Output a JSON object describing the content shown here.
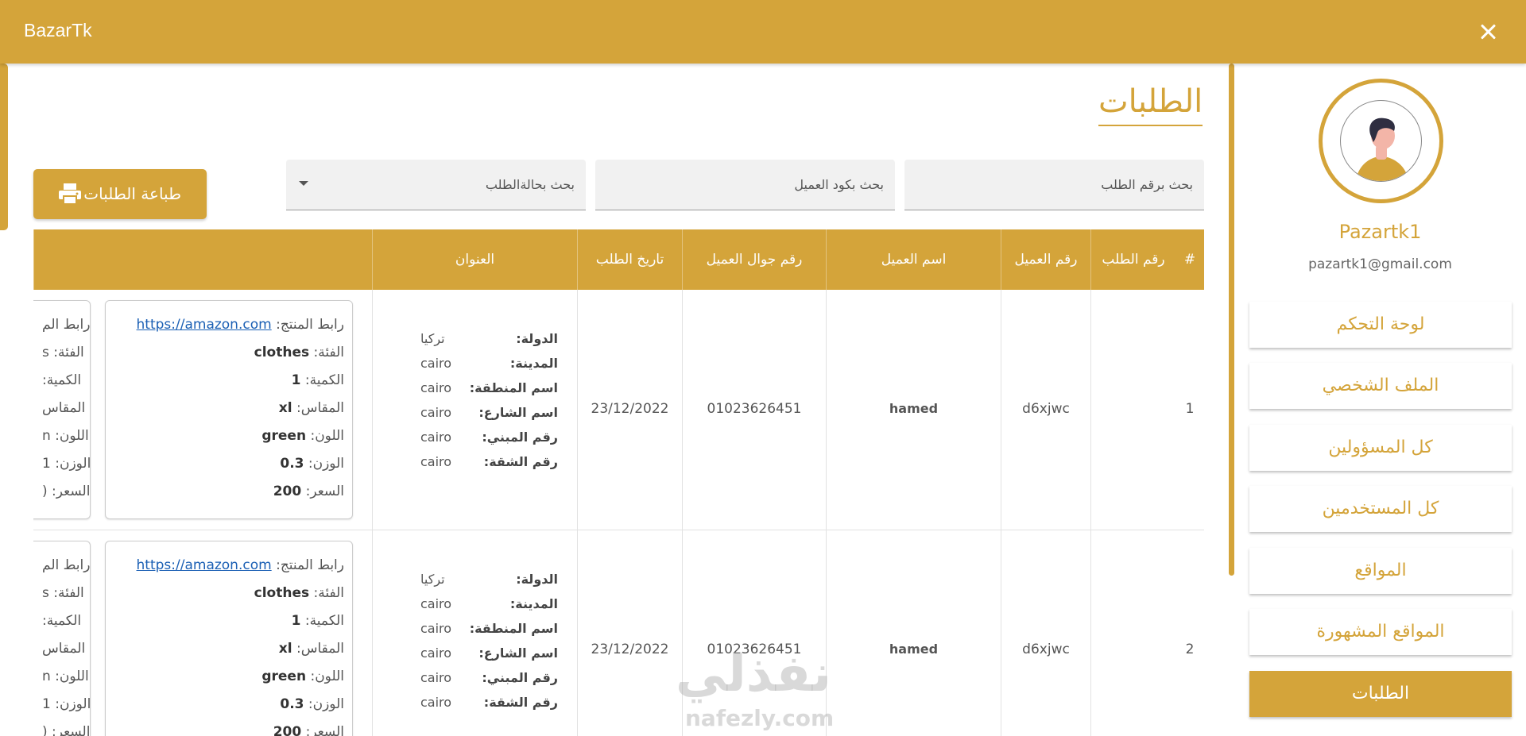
{
  "app": {
    "title": "BazarTk"
  },
  "sidebar": {
    "user_name": "Pazartk1",
    "user_email": "pazartk1@gmail.com",
    "items": [
      {
        "label": "لوحة التحكم"
      },
      {
        "label": "الملف الشخصي"
      },
      {
        "label": "كل المسؤولين"
      },
      {
        "label": "كل المستخدمين"
      },
      {
        "label": "المواقع"
      },
      {
        "label": "المواقع المشهورة"
      },
      {
        "label": "الطلبات",
        "active": true
      }
    ]
  },
  "main": {
    "page_title": "الطلبات",
    "filters": {
      "order_number_placeholder": "بحث برقم الطلب",
      "client_code_placeholder": "بحث بكود العميل",
      "status_placeholder": "بحث بحالةالطلب"
    },
    "print_button": "طباعة الطلبات",
    "table": {
      "headers": [
        "#",
        "رقم الطلب",
        "رقم العميل",
        "اسم العميل",
        "رقم جوال العميل",
        "تاريخ الطلب",
        "العنوان"
      ],
      "address_labels": [
        "الدولة:",
        "المدينة:",
        "اسم المنطقة:",
        "اسم الشارع:",
        "رقم المبني:",
        "رقم الشقة:"
      ],
      "product_labels": [
        "رابط المنتج:",
        "الفئة:",
        "الكمية:",
        "المقاس:",
        "اللون:",
        "الوزن:",
        "السعر:"
      ],
      "clipped_product_labels": [
        "رابط الم",
        "الفئة: s",
        "الكمية:",
        "المقاس",
        "اللون: n",
        "الوزن: 1",
        "السعر: ("
      ],
      "rows": [
        {
          "index": "1",
          "order_no": "",
          "client_no": "d6xjwc",
          "client_name": "hamed",
          "phone": "01023626451",
          "date": "23/12/2022",
          "address": [
            "تركيا",
            "cairo",
            "cairo",
            "cairo",
            "cairo",
            "cairo"
          ],
          "product": {
            "link": "https://amazon.com",
            "category": "clothes",
            "quantity": "1",
            "size": "xl",
            "color": "green",
            "weight": "0.3",
            "price": "200"
          }
        },
        {
          "index": "2",
          "order_no": "",
          "client_no": "d6xjwc",
          "client_name": "hamed",
          "phone": "01023626451",
          "date": "23/12/2022",
          "address": [
            "تركيا",
            "cairo",
            "cairo",
            "cairo",
            "cairo",
            "cairo"
          ],
          "product": {
            "link": "https://amazon.com",
            "category": "clothes",
            "quantity": "1",
            "size": "xl",
            "color": "green",
            "weight": "0.3",
            "price": "200"
          }
        }
      ]
    }
  },
  "watermark": {
    "arabic": "نفذلي",
    "latin": "nafezly.com"
  },
  "icons": {
    "close": "close-icon",
    "printer": "printer-icon",
    "dropdown": "chevron-down-icon",
    "avatar": "avatar-icon"
  },
  "colors": {
    "accent": "#d4a43a",
    "link": "#1a5fb4"
  }
}
